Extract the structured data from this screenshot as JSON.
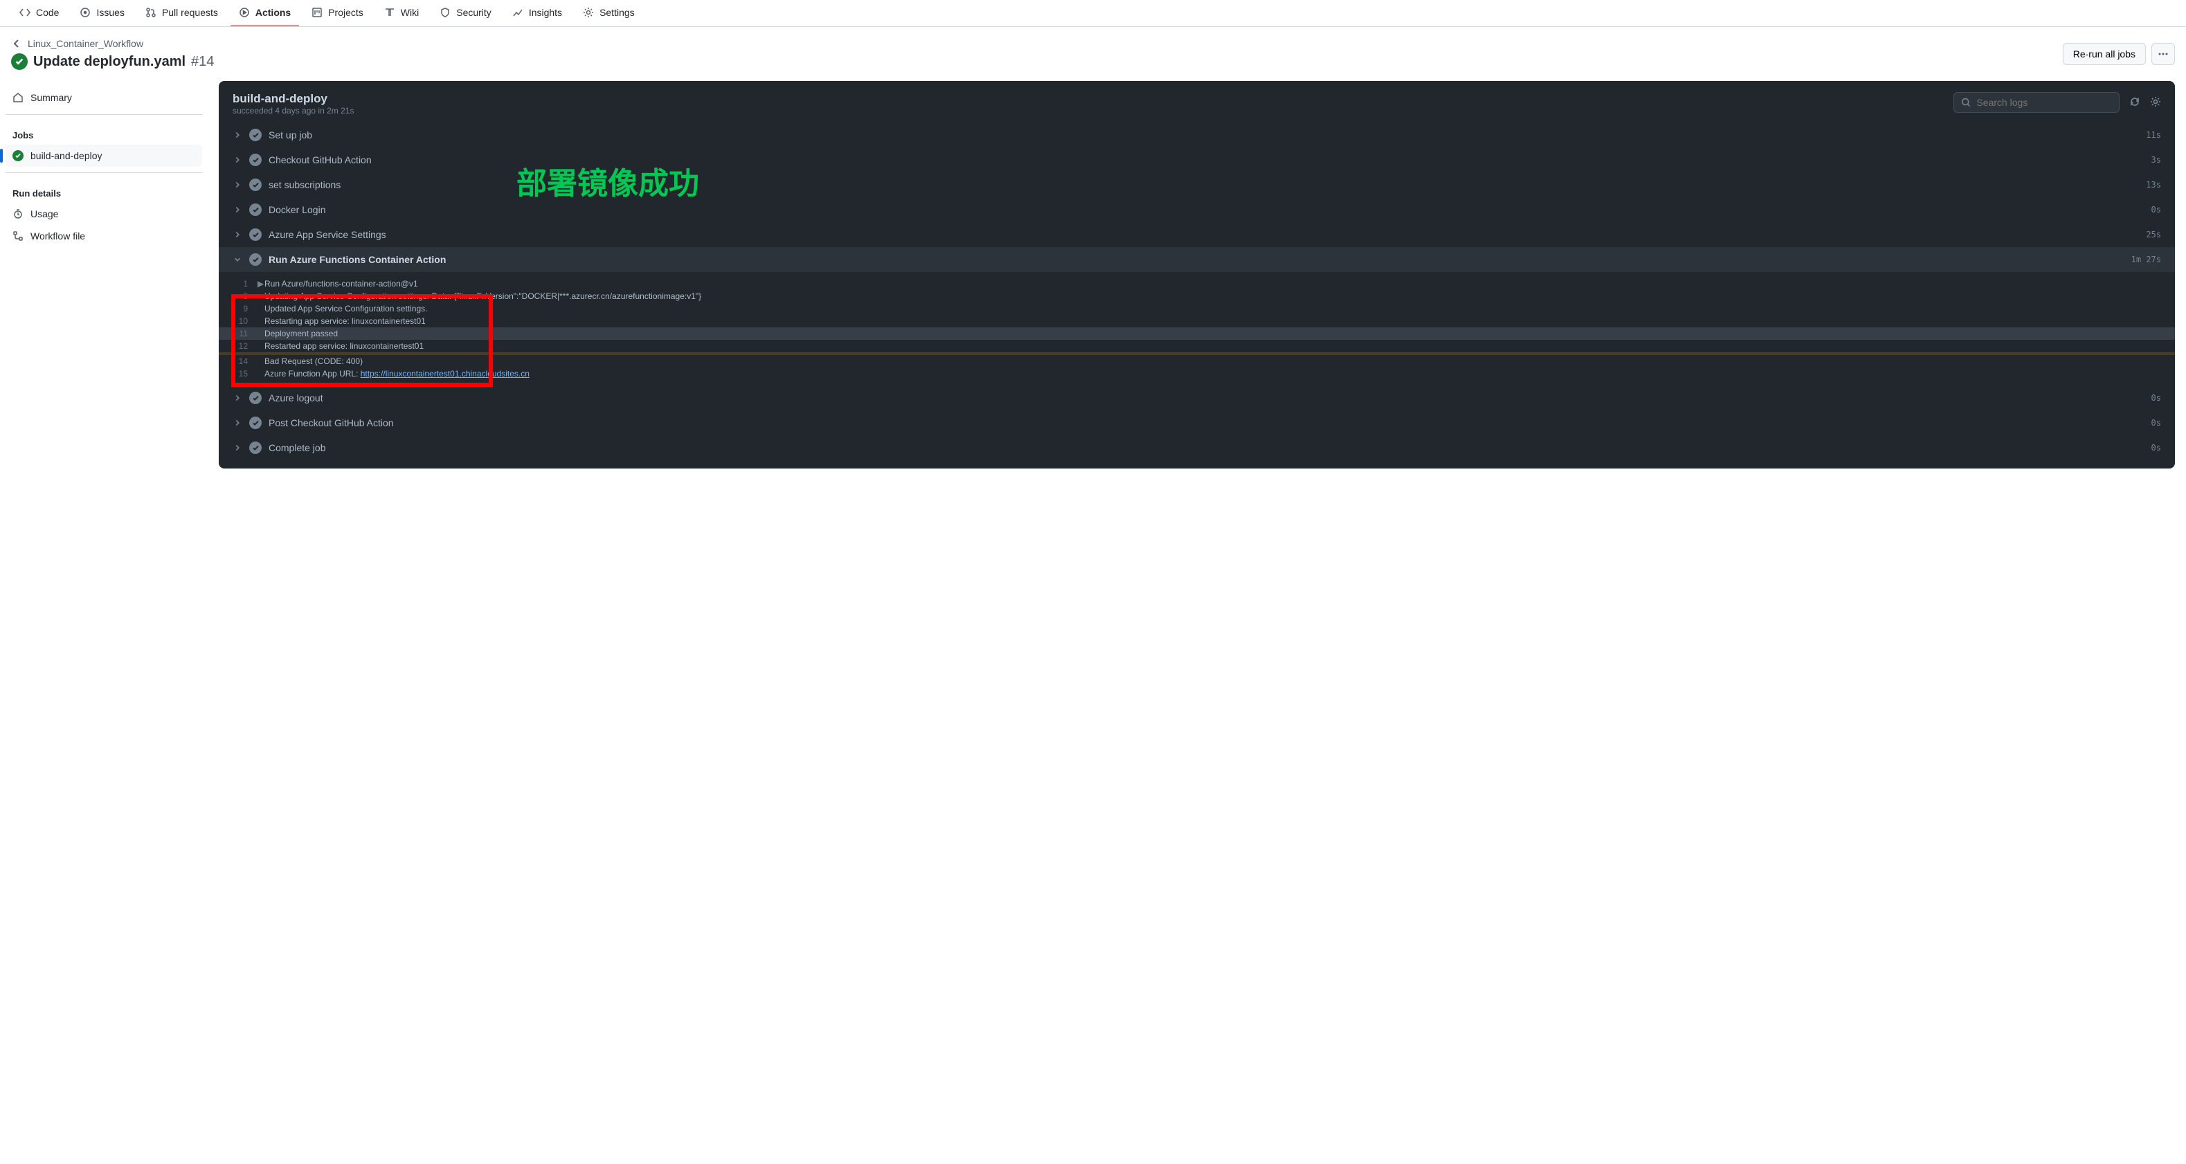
{
  "nav": {
    "code": "Code",
    "issues": "Issues",
    "pulls": "Pull requests",
    "actions": "Actions",
    "projects": "Projects",
    "wiki": "Wiki",
    "security": "Security",
    "insights": "Insights",
    "settings": "Settings"
  },
  "breadcrumb": "Linux_Container_Workflow",
  "title": "Update deployfun.yaml",
  "run_number": "#14",
  "rerun_label": "Re-run all jobs",
  "sidebar": {
    "summary": "Summary",
    "jobs_heading": "Jobs",
    "job1": "build-and-deploy",
    "run_details_heading": "Run details",
    "usage": "Usage",
    "workflow_file": "Workflow file"
  },
  "panel": {
    "title": "build-and-deploy",
    "subtitle": "succeeded 4 days ago in 2m 21s",
    "search_placeholder": "Search logs"
  },
  "overlay": "部署镜像成功",
  "steps": [
    {
      "name": "Set up job",
      "duration": "11s",
      "expanded": false
    },
    {
      "name": "Checkout GitHub Action",
      "duration": "3s",
      "expanded": false
    },
    {
      "name": "set subscriptions",
      "duration": "13s",
      "expanded": false
    },
    {
      "name": "Docker Login",
      "duration": "0s",
      "expanded": false
    },
    {
      "name": "Azure App Service Settings",
      "duration": "25s",
      "expanded": false
    },
    {
      "name": "Run Azure Functions Container Action",
      "duration": "1m 27s",
      "expanded": true
    },
    {
      "name": "Azure logout",
      "duration": "0s",
      "expanded": false
    },
    {
      "name": "Post Checkout GitHub Action",
      "duration": "0s",
      "expanded": false
    },
    {
      "name": "Complete job",
      "duration": "0s",
      "expanded": false
    }
  ],
  "log": {
    "l1_n": "1",
    "l1_t": "Run Azure/functions-container-action@v1",
    "l8_n": "8",
    "l8_t": "Updating App Service Configuration settings. Data: {\"linuxFxVersion\":\"DOCKER|***.azurecr.cn/azurefunctionimage:v1\"}",
    "l9_n": "9",
    "l9_t": "Updated App Service Configuration settings.",
    "l10_n": "10",
    "l10_t": "Restarting app service: linuxcontainertest01",
    "l11_n": "11",
    "l11_t": "Deployment passed",
    "l12_n": "12",
    "l12_t": "Restarted app service: linuxcontainertest01",
    "l14_n": "14",
    "l14_t": "Bad Request (CODE: 400)",
    "l15_n": "15",
    "l15_t": "Azure Function App URL: ",
    "l15_url": "https://linuxcontainertest01.chinacloudsites.cn"
  }
}
